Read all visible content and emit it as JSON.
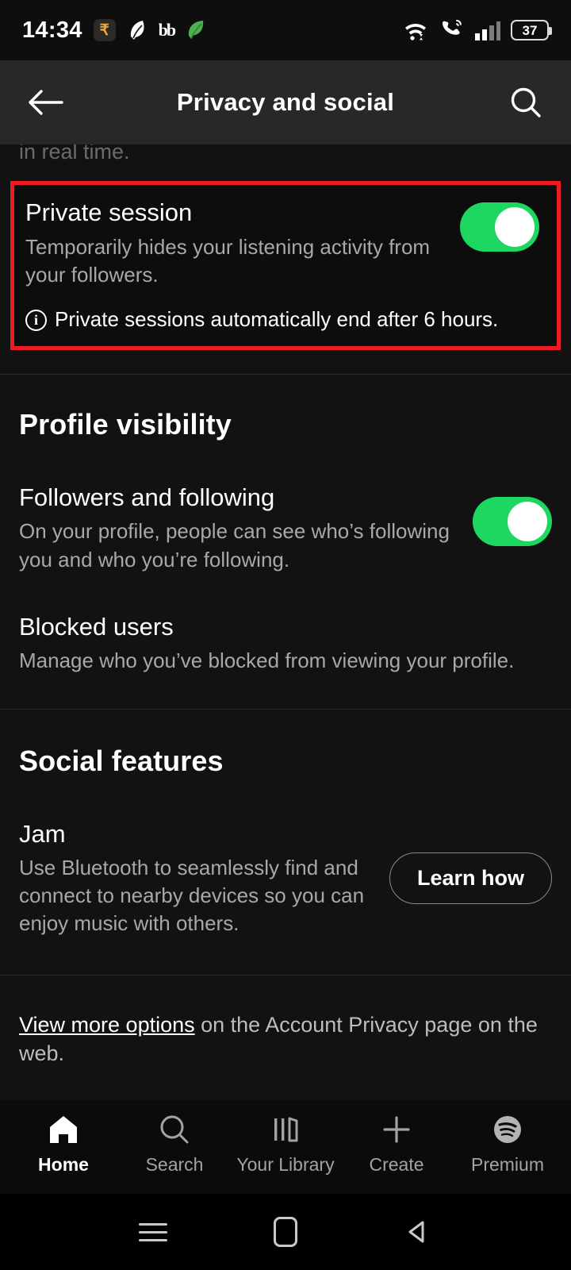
{
  "statusbar": {
    "time": "14:34",
    "battery_percent": "37",
    "icons": [
      "rupee-app-icon",
      "feather-app-icon",
      "bb-app-icon",
      "leaf-app-icon",
      "wifi-icon",
      "call-icon",
      "signal-icon",
      "battery-icon"
    ]
  },
  "header": {
    "title": "Privacy and social",
    "back_icon": "back-arrow-icon",
    "search_icon": "search-icon"
  },
  "content": {
    "cut_off_text": "in real time.",
    "private_session": {
      "title": "Private session",
      "description": "Temporarily hides your listening activity from your followers.",
      "note": "Private sessions automatically end after 6 hours.",
      "toggle_state": "on",
      "highlight_color": "#ed1c24"
    },
    "profile_visibility": {
      "heading": "Profile visibility",
      "items": [
        {
          "title": "Followers and following",
          "description": "On your profile, people can see who’s following you and who you’re following.",
          "toggle_state": "on"
        },
        {
          "title": "Blocked users",
          "description": "Manage who you’ve blocked from viewing your profile."
        }
      ]
    },
    "social_features": {
      "heading": "Social features",
      "items": [
        {
          "title": "Jam",
          "description": "Use Bluetooth to seamlessly find and connect to nearby devices so you can enjoy music with others.",
          "button_label": "Learn how"
        }
      ]
    },
    "footer": {
      "link_text": "View more options",
      "rest_text": " on the Account Privacy page on the web."
    }
  },
  "bottom_nav": {
    "items": [
      {
        "label": "Home",
        "icon": "home-icon",
        "active": true
      },
      {
        "label": "Search",
        "icon": "search-icon",
        "active": false
      },
      {
        "label": "Your Library",
        "icon": "library-icon",
        "active": false
      },
      {
        "label": "Create",
        "icon": "plus-icon",
        "active": false
      },
      {
        "label": "Premium",
        "icon": "spotify-logo-icon",
        "active": false
      }
    ]
  },
  "system_nav": {
    "recents": "recents-icon",
    "home": "home-square-icon",
    "back": "back-triangle-icon"
  },
  "colors": {
    "accent_green": "#1ed760",
    "highlight_red": "#ed1c24",
    "bg": "#121212",
    "appbar": "#282828"
  }
}
